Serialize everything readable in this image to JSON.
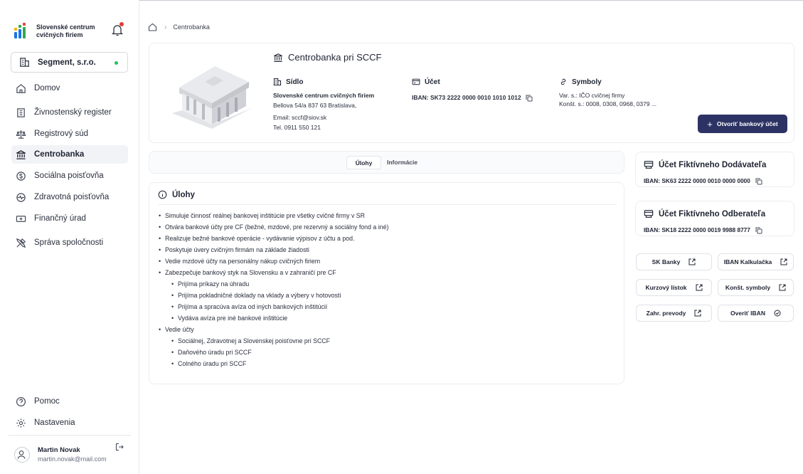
{
  "sidebar": {
    "brand_name": "Slovenské centrum cvičných firiem",
    "segment": "Segment, s.r.o.",
    "items": [
      {
        "label": "Domov"
      },
      {
        "label": "Živnostenský register"
      },
      {
        "label": "Registrový súd"
      },
      {
        "label": "Centrobanka"
      },
      {
        "label": "Sociálna poisťovňa"
      },
      {
        "label": "Zdravotná poisťovňa"
      },
      {
        "label": "Finančný úrad"
      },
      {
        "label": "Správa spoločnosti"
      }
    ],
    "bottom_items": [
      {
        "label": "Pomoc"
      },
      {
        "label": "Nastavenia"
      }
    ],
    "user": {
      "name": "Martin Novak",
      "email": "martin.novak@mail.com"
    }
  },
  "breadcrumb": {
    "current": "Centrobanka"
  },
  "bank": {
    "title": "Centrobanka pri SCCF",
    "seat": {
      "heading": "Sídlo",
      "name": "Slovenské centrum cvičných firiem",
      "address": "Bellova 54/a 837 63 Bratislava,",
      "email": "Email: sccf@siov.sk",
      "phone": "Tel. 0911 550 121"
    },
    "account": {
      "heading": "Účet",
      "iban": "IBAN: SK73 2222 0000 0010 1010 1012"
    },
    "symbols": {
      "heading": "Symboly",
      "var": "Var. s.: IČO cvičnej firmy",
      "konst": "Konšt. s.: 0008, 0308, 0968, 0379 ..."
    },
    "open_account_button": "Otvoriť bankový účet"
  },
  "tabs": [
    {
      "label": "Úlohy"
    },
    {
      "label": "Informácie"
    }
  ],
  "tasks": {
    "heading": "Úlohy",
    "items": [
      "Simuluje činnosť reálnej bankovej inštitúcie pre všetky cvičné firmy v SR",
      "Otvára bankové účty pre CF (bežné, mzdové, pre rezervný a sociálny fond a iné)",
      "Realizuje bežné bankové operácie - vydávanie výpisov z účtu a pod.",
      "Poskytuje úvery cvičným firmám na základe žiadosti",
      "Vedie mzdové účty na personálny nákup cvičných firiem",
      "Zabezpečuje bankový styk na Slovensku a v zahraničí pre CF"
    ],
    "sub_items_1": [
      "Prijíma príkazy na úhradu",
      "Prijíma pokladničné doklady na vklady a výbery v hotovosti",
      "Prijíma a spracúva avíza od iných bankových inštitúcií",
      "Vydáva avíza pre iné bankové inštitúcie"
    ],
    "item_7": "Vedie účty",
    "sub_items_2": [
      "Sociálnej, Zdravotnej a Slovenskej poisťovne pri SCCF",
      "Daňového úradu pri SCCF",
      "Colného úradu pri SCCF"
    ]
  },
  "supplier": {
    "title": "Účet Fiktívneho Dodávateľa",
    "iban": "IBAN:  SK63 2222 0000 0010 0000 0000"
  },
  "customer": {
    "title": "Účet Fiktívneho Odberateľa",
    "iban": "IBAN:  SK18 2222 0000 0019 9988 8777"
  },
  "links": {
    "sk_banky": "SK Banky",
    "iban_kalk": "IBAN Kalkulačka",
    "kurzovy": "Kurzový lístok",
    "konst": "Konšt. symboly",
    "zahr": "Zahr. prevody",
    "overit": "Overiť IBAN"
  },
  "colors": {
    "primary": "#2c3364",
    "online": "#22c55e",
    "alert": "#e23b3b"
  }
}
